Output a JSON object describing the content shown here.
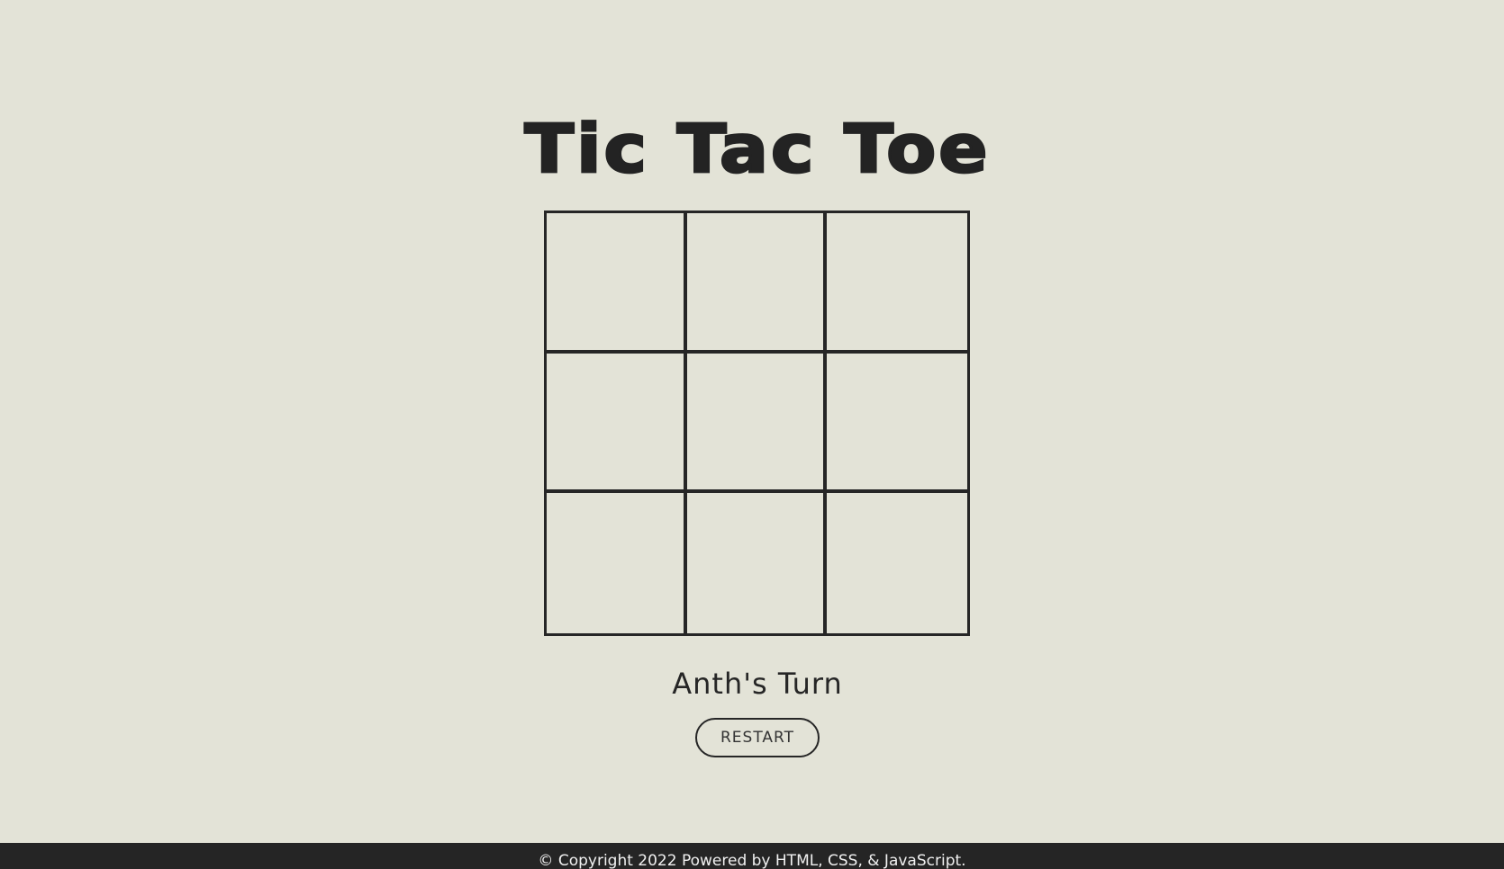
{
  "app": {
    "title": "Tic Tac Toe"
  },
  "board": {
    "cells": [
      "",
      "",
      "",
      "",
      "",
      "",
      "",
      "",
      ""
    ]
  },
  "status": {
    "turn_text": "Anth's Turn"
  },
  "controls": {
    "restart_label": "RESTART"
  },
  "footer": {
    "text": "© Copyright 2022 Powered by HTML, CSS, & JavaScript."
  },
  "colors": {
    "background": "#e3e3d7",
    "ink": "#262626",
    "footer_bg": "#252525"
  }
}
